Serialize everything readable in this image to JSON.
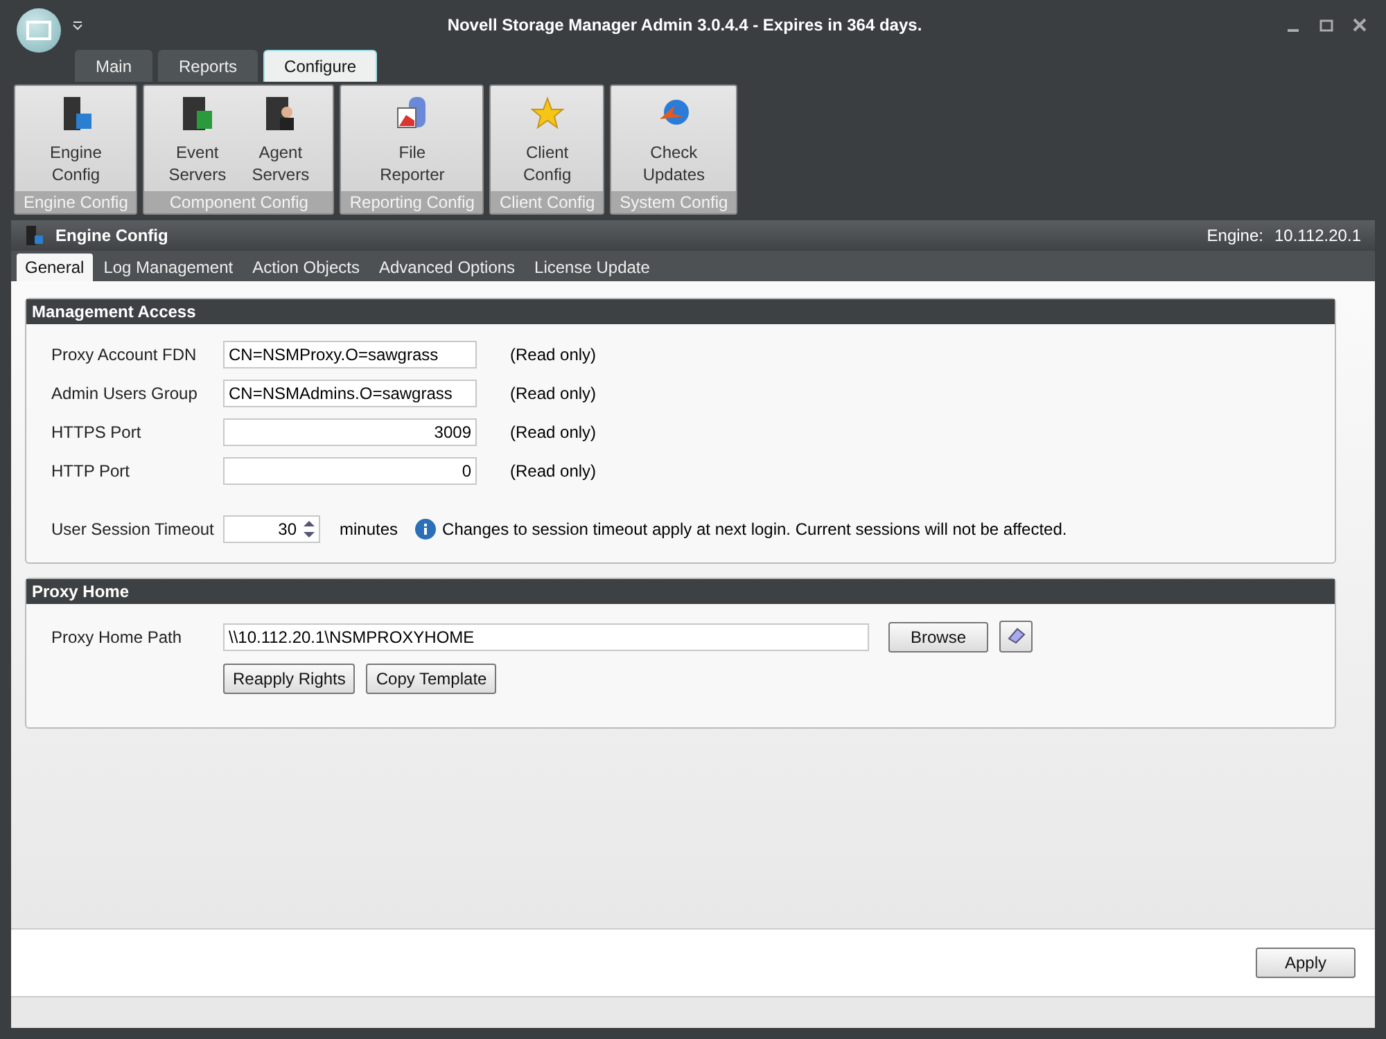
{
  "window": {
    "title": "Novell Storage Manager Admin 3.0.4.4 - Expires in 364 days."
  },
  "ribbon_tabs": [
    {
      "label": "Main",
      "selected": false
    },
    {
      "label": "Reports",
      "selected": false
    },
    {
      "label": "Configure",
      "selected": true
    }
  ],
  "ribbon_groups": [
    {
      "label": "Engine Config",
      "buttons": [
        {
          "label": "Engine Config",
          "kind": "engine"
        }
      ]
    },
    {
      "label": "Component Config",
      "buttons": [
        {
          "label": "Event Servers",
          "kind": "event"
        },
        {
          "label": "Agent Servers",
          "kind": "agent"
        }
      ]
    },
    {
      "label": "Reporting Config",
      "buttons": [
        {
          "label": "File Reporter",
          "kind": "reporter"
        }
      ]
    },
    {
      "label": "Client Config",
      "buttons": [
        {
          "label": "Client Config",
          "kind": "star"
        }
      ]
    },
    {
      "label": "System Config",
      "buttons": [
        {
          "label": "Check Updates",
          "kind": "update"
        }
      ]
    }
  ],
  "section": {
    "title": "Engine Config",
    "engine_label": "Engine:",
    "engine_value": "10.112.20.1"
  },
  "sub_tabs": [
    {
      "label": "General",
      "selected": true
    },
    {
      "label": "Log Management",
      "selected": false
    },
    {
      "label": "Action Objects",
      "selected": false
    },
    {
      "label": "Advanced Options",
      "selected": false
    },
    {
      "label": "License Update",
      "selected": false
    }
  ],
  "management_access": {
    "title": "Management Access",
    "fields": [
      {
        "label": "Proxy Account FDN",
        "value": "CN=NSMProxy.O=sawgrass",
        "kind": "text",
        "note": "(Read only)"
      },
      {
        "label": "Admin Users Group",
        "value": "CN=NSMAdmins.O=sawgrass",
        "kind": "text",
        "note": "(Read only)"
      },
      {
        "label": "HTTPS Port",
        "value": "3009",
        "kind": "number",
        "note": "(Read only)"
      },
      {
        "label": "HTTP Port",
        "value": "0",
        "kind": "number",
        "note": "(Read only)"
      }
    ],
    "timeout": {
      "label": "User Session Timeout",
      "value": "30",
      "unit": "minutes",
      "info": "Changes to session timeout apply at next login.  Current sessions will not be affected."
    }
  },
  "proxy_home": {
    "title": "Proxy Home",
    "label": "Proxy Home Path",
    "value": "\\\\10.112.20.1\\NSMPROXYHOME",
    "browse": "Browse",
    "buttons": [
      "Reapply Rights",
      "Copy Template"
    ]
  },
  "apply": "Apply"
}
